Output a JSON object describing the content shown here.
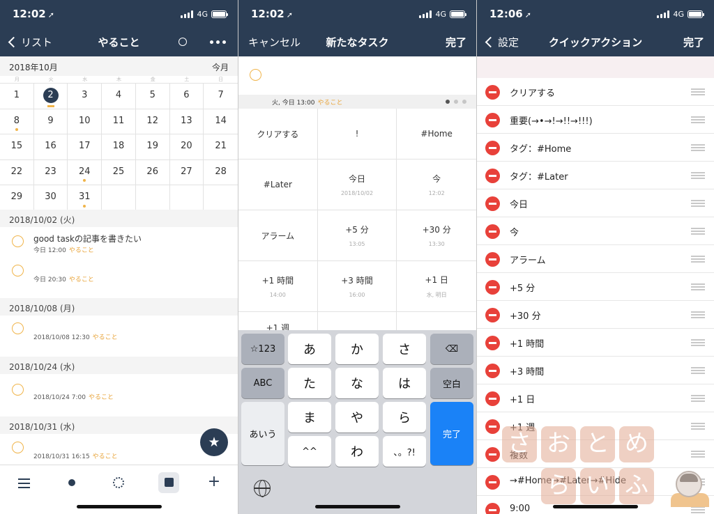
{
  "panel1": {
    "status": {
      "time": "12:02",
      "network": "4G"
    },
    "nav": {
      "back_label": "リスト",
      "title": "やること"
    },
    "month": {
      "label": "2018年10月",
      "today_label": "今月"
    },
    "weekdays": [
      "月",
      "火",
      "水",
      "木",
      "金",
      "土",
      "日"
    ],
    "calendar_rows": [
      [
        "1",
        "2",
        "3",
        "4",
        "5",
        "6",
        "7"
      ],
      [
        "8",
        "9",
        "10",
        "11",
        "12",
        "13",
        "14"
      ],
      [
        "15",
        "16",
        "17",
        "18",
        "19",
        "20",
        "21"
      ],
      [
        "22",
        "23",
        "24",
        "25",
        "26",
        "27",
        "28"
      ],
      [
        "29",
        "30",
        "31",
        "",
        "",
        "",
        ""
      ]
    ],
    "sections": [
      {
        "header": "2018/10/02 (火)"
      },
      {
        "header": "2018/10/08 (月)"
      },
      {
        "header": "2018/10/24 (水)"
      },
      {
        "header": "2018/10/31 (水)"
      }
    ],
    "tasks": [
      {
        "title": "good taskの記事を書きたい",
        "meta": "今日 12:00",
        "project": "やること"
      },
      {
        "title": "",
        "meta": "今日 20:30",
        "project": "やること"
      },
      {
        "title": "",
        "meta": "2018/10/08 12:30",
        "project": "やること"
      },
      {
        "title": "",
        "meta": "2018/10/24 7:00",
        "project": "やること"
      },
      {
        "title": "",
        "meta": "2018/10/31 16:15",
        "project": "やること"
      }
    ],
    "fab_icon": "star-icon"
  },
  "panel2": {
    "status": {
      "time": "12:02",
      "network": "4G"
    },
    "nav": {
      "cancel_label": "キャンセル",
      "title": "新たなタスク",
      "done_label": "完了"
    },
    "info": {
      "text": "火, 今日 13:00",
      "project": "やること"
    },
    "quick_actions": [
      {
        "label": "クリアする",
        "sub": ""
      },
      {
        "label": "!",
        "sub": ""
      },
      {
        "label": "#Home",
        "sub": ""
      },
      {
        "label": "#Later",
        "sub": ""
      },
      {
        "label": "今日",
        "sub": "2018/10/02"
      },
      {
        "label": "今",
        "sub": "12:02"
      },
      {
        "label": "アラーム",
        "sub": ""
      },
      {
        "label": "+5 分",
        "sub": "13:05"
      },
      {
        "label": "+30 分",
        "sub": "13:30"
      },
      {
        "label": "+1 時間",
        "sub": "14:00"
      },
      {
        "label": "+3 時間",
        "sub": "16:00"
      },
      {
        "label": "+1 日",
        "sub": "水, 明日"
      },
      {
        "label": "+1 週",
        "sub": ""
      },
      {
        "label": "",
        "sub": ""
      },
      {
        "label": "",
        "sub": ""
      }
    ],
    "keyboard": {
      "sym": "☆123",
      "abc": "ABC",
      "aiu": "あいう",
      "row1": [
        "あ",
        "か",
        "さ"
      ],
      "row2": [
        "た",
        "な",
        "は"
      ],
      "row3": [
        "ま",
        "や",
        "ら"
      ],
      "row4": [
        "^^",
        "わ",
        "、。?!"
      ],
      "space": "空白",
      "done": "完了"
    }
  },
  "panel3": {
    "status": {
      "time": "12:06",
      "network": "4G"
    },
    "nav": {
      "back_label": "設定",
      "title": "クイックアクション",
      "done_label": "完了"
    },
    "items": [
      "クリアする",
      "重要(→•→!→!!→!!!)",
      "タグ：#Home",
      "タグ：#Later",
      "今日",
      "今",
      "アラーム",
      "+5 分",
      "+30 分",
      "+1 時間",
      "+3 時間",
      "+1 日",
      "+1 週",
      "複数",
      "→#Home→#Later→#Hide",
      "9:00"
    ],
    "watermark": [
      "さ",
      "お",
      "と",
      "め",
      "ら",
      "い",
      "ふ"
    ]
  }
}
